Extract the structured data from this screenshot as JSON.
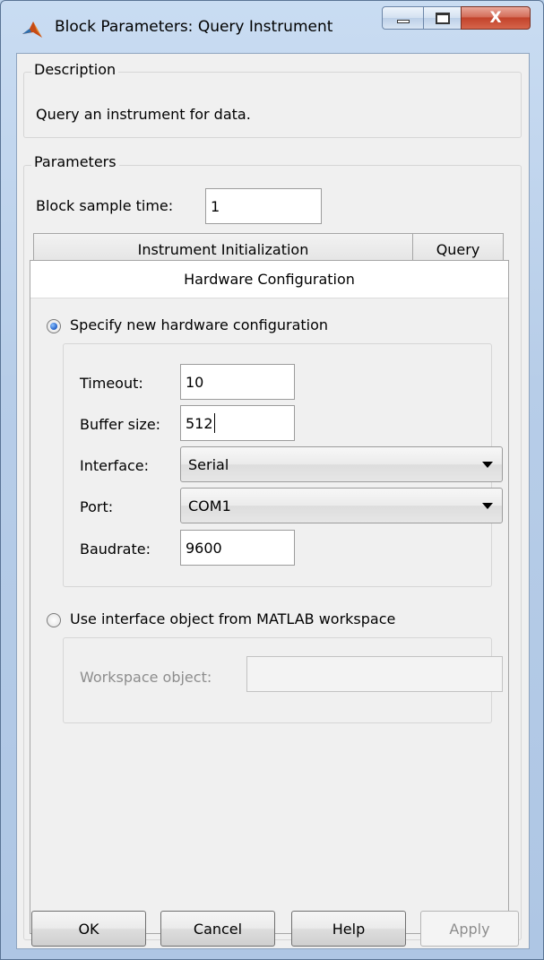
{
  "window": {
    "title": "Block Parameters: Query Instrument",
    "close_glyph": "X",
    "icons": {
      "app": "matlab-logo-icon",
      "minimize": "minimize-icon",
      "maximize": "maximize-icon",
      "close": "close-icon"
    }
  },
  "description": {
    "heading": "Description",
    "text": "Query an instrument for data."
  },
  "parameters": {
    "heading": "Parameters",
    "sample_time_label": "Block sample time:",
    "sample_time_value": "1"
  },
  "tabs": [
    {
      "label": "Instrument Initialization"
    },
    {
      "label": "Query"
    },
    {
      "label": "Hardware Configuration",
      "selected": true
    }
  ],
  "hardware": {
    "option_new_label": "Specify new hardware configuration",
    "option_workspace_label": "Use interface object from MATLAB workspace",
    "selected_option": "new",
    "timeout_label": "Timeout:",
    "timeout_value": "10",
    "buffer_label": "Buffer size:",
    "buffer_value": "512",
    "interface_label": "Interface:",
    "interface_value": "Serial",
    "port_label": "Port:",
    "port_value": "COM1",
    "baudrate_label": "Baudrate:",
    "baudrate_value": "9600",
    "workspace_object_label": "Workspace object:",
    "workspace_object_value": ""
  },
  "buttons": {
    "ok": "OK",
    "cancel": "Cancel",
    "help": "Help",
    "apply": "Apply"
  },
  "colors": {
    "title_bar": "#c9dcf2",
    "close_button": "#c2432b",
    "dialog_background": "#f0f0f0",
    "radio_selected": "#1f5ec7"
  }
}
